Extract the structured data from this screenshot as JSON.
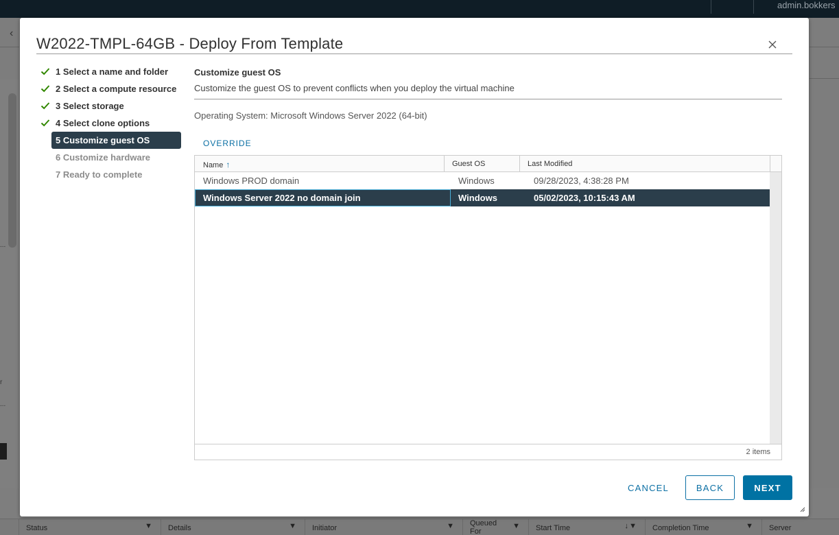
{
  "background": {
    "user_label": "admin.bokkers",
    "bottom_table_headers": [
      {
        "label": "Status"
      },
      {
        "label": "Details"
      },
      {
        "label": "Initiator"
      },
      {
        "label": "Queued For"
      },
      {
        "label": "Start Time"
      },
      {
        "label": "Completion Time"
      },
      {
        "label": "Server"
      }
    ],
    "side_fragments": [
      "...",
      "r",
      "..."
    ]
  },
  "dialog": {
    "title": "W2022-TMPL-64GB - Deploy From Template",
    "close_icon": "close-icon"
  },
  "steps": [
    {
      "label": "1 Select a name and folder",
      "state": "done"
    },
    {
      "label": "2 Select a compute resource",
      "state": "done"
    },
    {
      "label": "3 Select storage",
      "state": "done"
    },
    {
      "label": "4 Select clone options",
      "state": "done"
    },
    {
      "label": "5 Customize guest OS",
      "state": "active"
    },
    {
      "label": "6 Customize hardware",
      "state": "pending"
    },
    {
      "label": "7 Ready to complete",
      "state": "pending"
    }
  ],
  "content": {
    "title": "Customize guest OS",
    "description": "Customize the guest OS to prevent conflicts when you deploy the virtual machine",
    "os_line": "Operating System: Microsoft Windows Server 2022 (64-bit)",
    "override_label": "OVERRIDE"
  },
  "grid": {
    "columns": [
      "Name",
      "Guest OS",
      "Last Modified"
    ],
    "sort": {
      "column": "Name",
      "direction": "ascending"
    },
    "rows": [
      {
        "name": "Windows PROD domain",
        "guest_os": "Windows",
        "last_modified": "09/28/2023, 4:38:28 PM",
        "selected": false
      },
      {
        "name": "Windows Server 2022 no domain join",
        "guest_os": "Windows",
        "last_modified": "05/02/2023, 10:15:43 AM",
        "selected": true
      }
    ],
    "footer_count": "2 items"
  },
  "buttons": {
    "cancel": "CANCEL",
    "back": "BACK",
    "next": "NEXT"
  },
  "colors": {
    "accent": "#0072a3",
    "selected_row": "#2b3e4b",
    "check": "#318700"
  }
}
